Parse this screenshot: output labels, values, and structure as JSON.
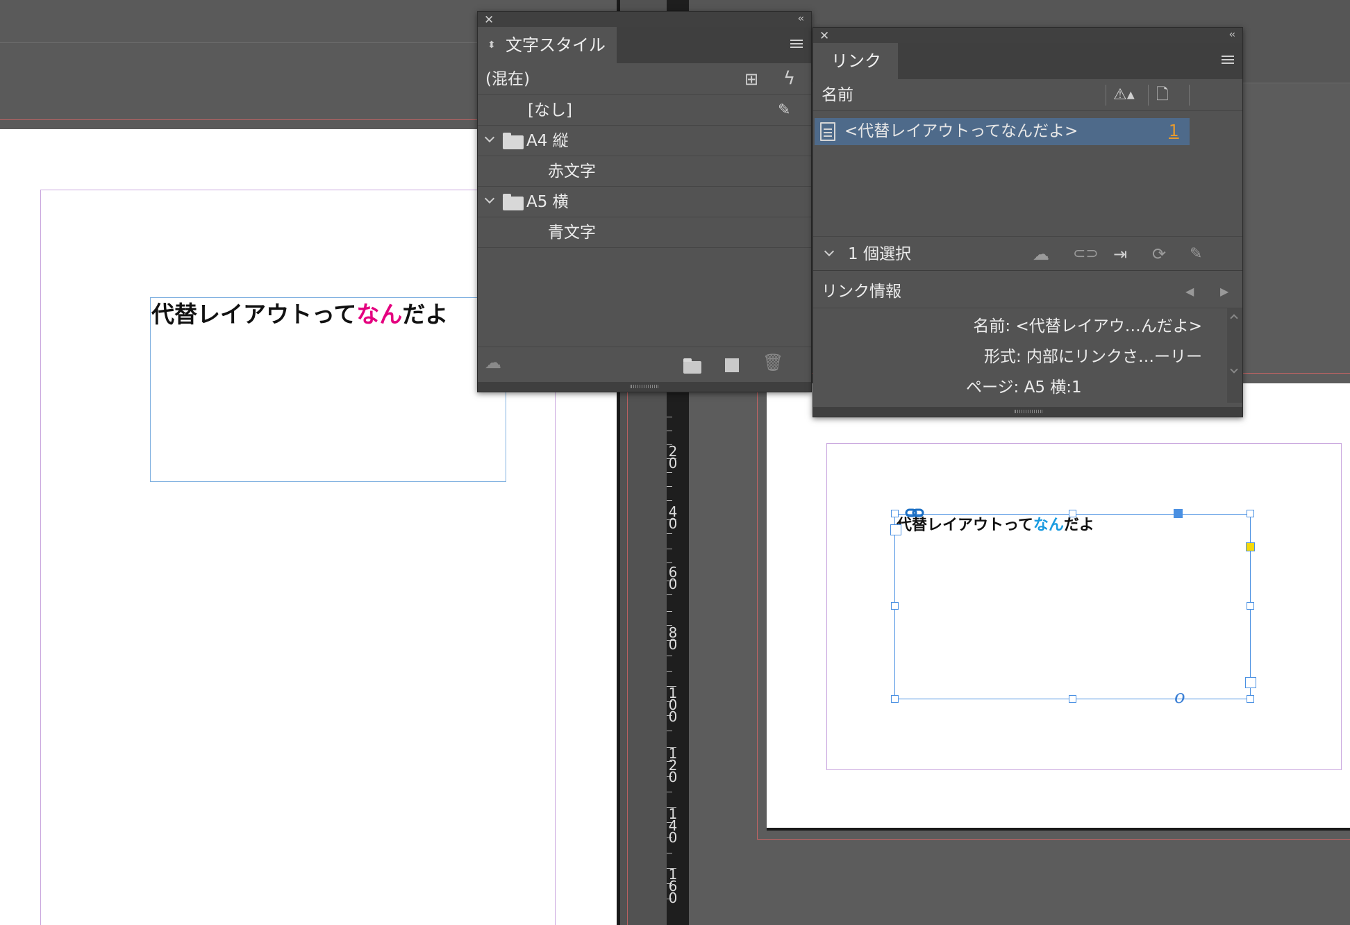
{
  "left_document": {
    "text_plain_1": "代替レイアウトって",
    "text_accent": "なん",
    "text_plain_2": "だよ",
    "accent_color": "#e4007f"
  },
  "right_document": {
    "text_plain_1": "代替レイアウトって",
    "text_accent": "なん",
    "text_plain_2": "だよ",
    "accent_color": "#1a9be0"
  },
  "ruler": {
    "labels": [
      "2\n0",
      "4\n0",
      "6\n0",
      "8\n0",
      "1\n0\n0",
      "1\n2\n0",
      "1\n4\n0",
      "1\n6\n0"
    ]
  },
  "char_styles_panel": {
    "tab_label": "文字スタイル",
    "current_style": "(混在)",
    "items": [
      {
        "label": "[なし]"
      },
      {
        "label": "A4 縦"
      },
      {
        "label": "赤文字"
      },
      {
        "label": "A5 横"
      },
      {
        "label": "青文字"
      }
    ]
  },
  "links_panel": {
    "tab_label": "リンク",
    "column_name": "名前",
    "link_row_name": "<代替レイアウトってなんだよ>",
    "link_row_page": "1",
    "selection_count": "1 個選択",
    "info_header": "リンク情報",
    "info_rows": [
      {
        "label": "名前:",
        "value": "<代替レイアウ…んだよ>"
      },
      {
        "label": "形式:",
        "value": "内部にリンクさ…ーリー"
      },
      {
        "label": "ページ:",
        "value": "A5 横:1"
      }
    ]
  }
}
